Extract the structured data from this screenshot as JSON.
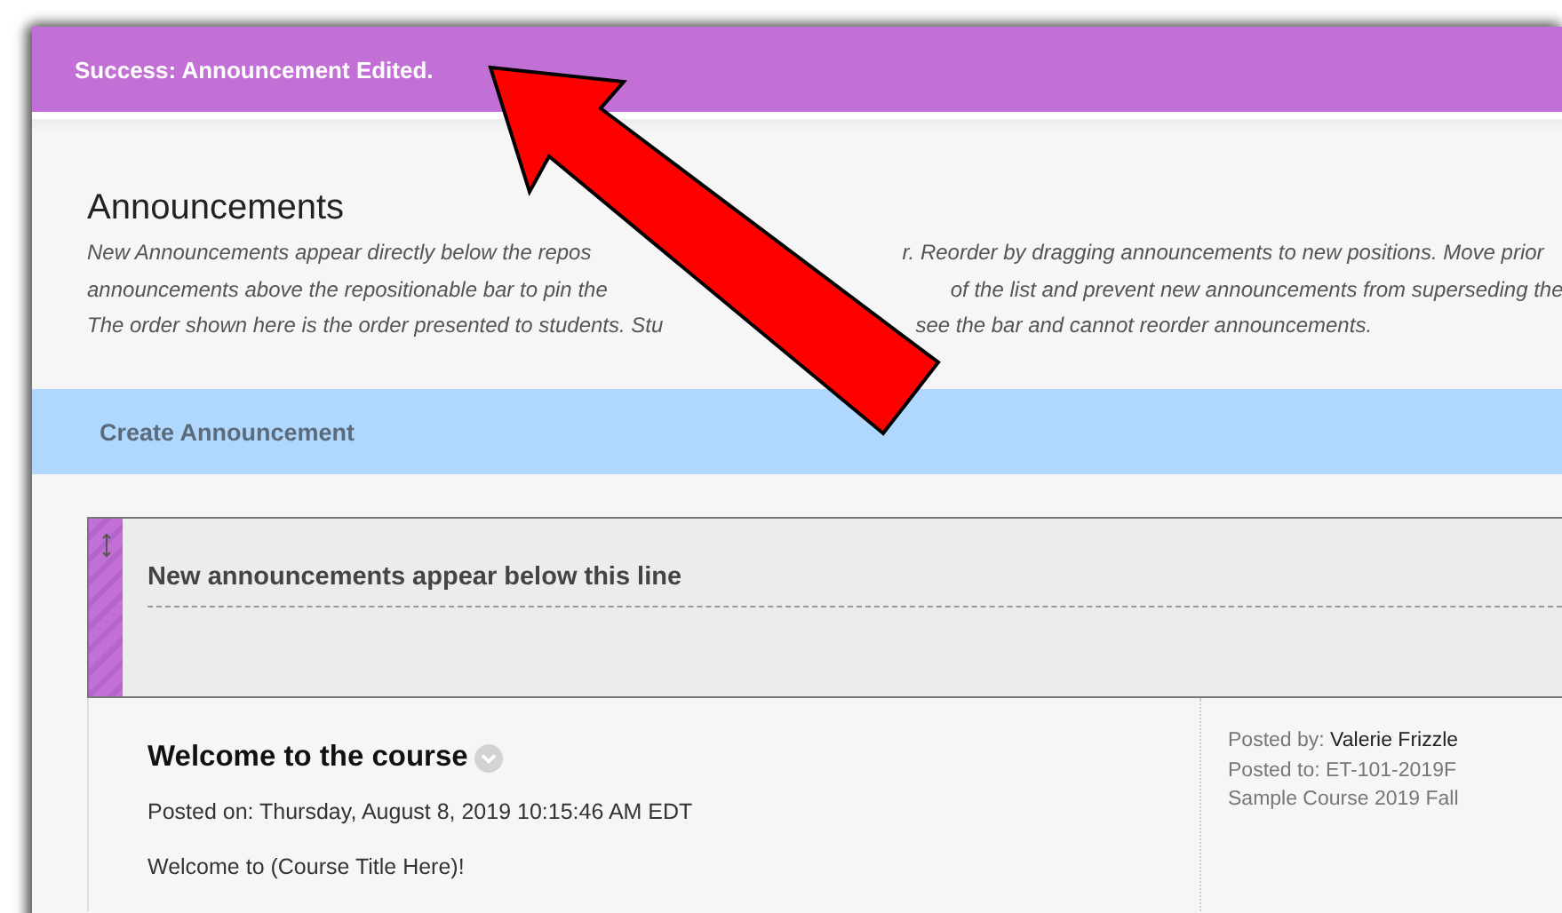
{
  "banner": {
    "message": "Success: Announcement Edited."
  },
  "page": {
    "title": "Announcements",
    "description_lines": [
      [
        "New Announcements appear directly below the repos",
        "r. Reorder by dragging announcements to new positions. Move prior"
      ],
      [
        "announcements above the repositionable bar to pin the",
        "of the list and prevent new announcements from superseding the"
      ],
      [
        "The order shown here is the order presented to students. Stu",
        "see the bar and cannot reorder announcements."
      ]
    ]
  },
  "toolbar": {
    "button": "Create Announcement"
  },
  "divider_bar": {
    "label": "New announcements appear below this line"
  },
  "announcements": [
    {
      "title": "Welcome to the course",
      "posted_on": "Posted on: Thursday, August 8, 2019 10:15:46 AM EDT",
      "body": "Welcome to (Course Title Here)!",
      "posted_by_label": "Posted by:",
      "posted_by": "Valerie Frizzle",
      "posted_to_label": "Posted to:",
      "posted_to": "ET-101-2019F",
      "course": "Sample Course 2019 Fall"
    }
  ]
}
